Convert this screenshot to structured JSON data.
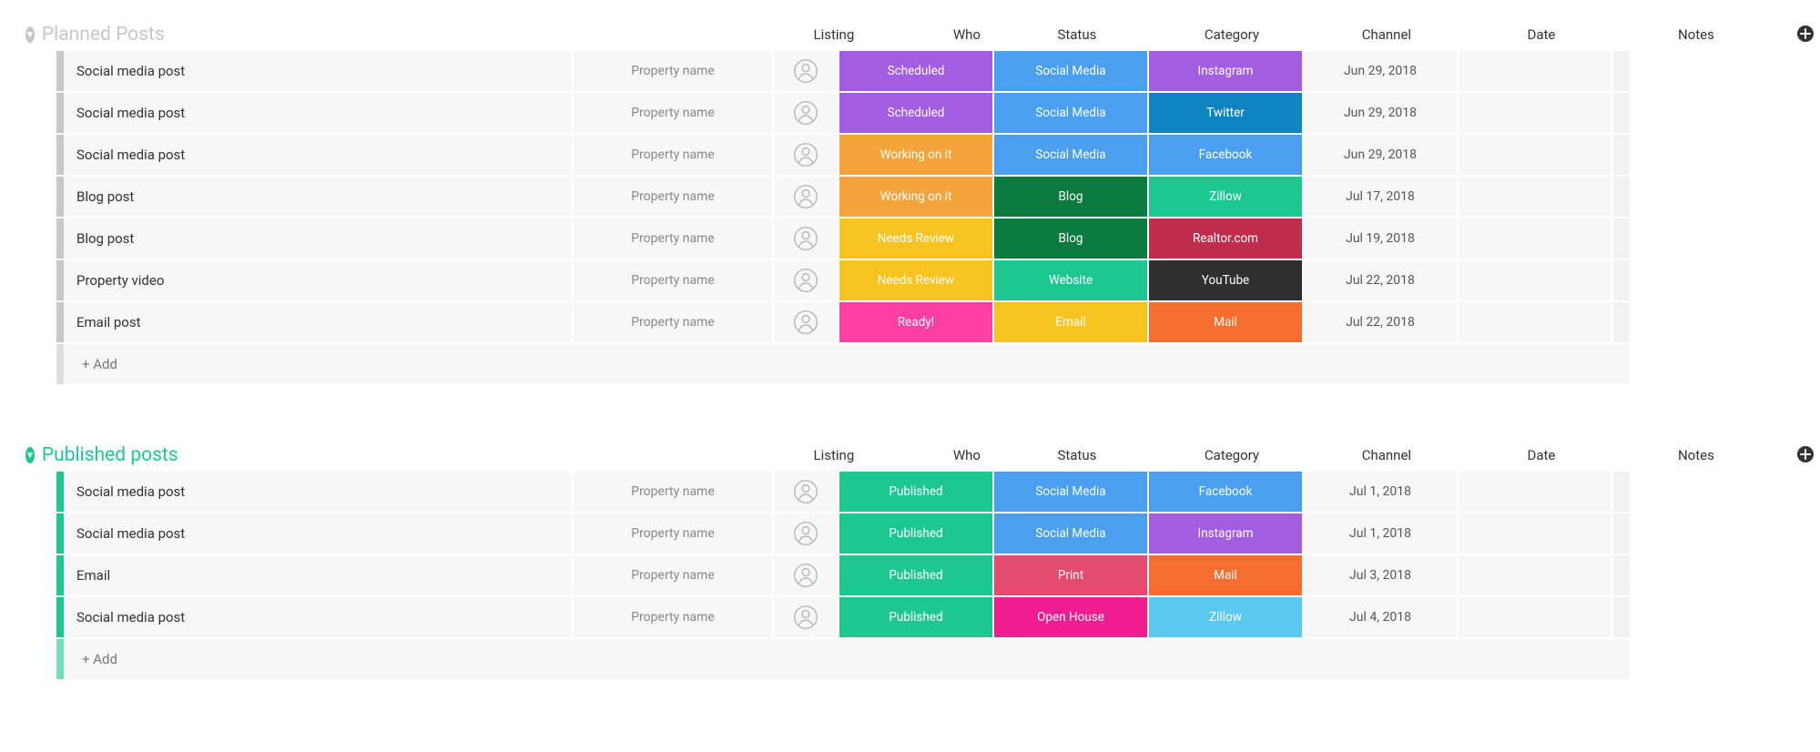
{
  "columns": {
    "listing": "Listing",
    "who": "Who",
    "status": "Status",
    "category": "Category",
    "channel": "Channel",
    "date": "Date",
    "notes": "Notes"
  },
  "add_label": "+ Add",
  "plus_glyph": "+",
  "groups": [
    {
      "id": "planned",
      "title": "Planned Posts",
      "tone": "muted",
      "rows": [
        {
          "name": "Social media post",
          "listing": "Property name",
          "status": {
            "label": "Scheduled",
            "color": "#a35de0"
          },
          "category": {
            "label": "Social Media",
            "color": "#4a9ff0"
          },
          "channel": {
            "label": "Instagram",
            "color": "#a35de0"
          },
          "date": "Jun 29, 2018"
        },
        {
          "name": "Social media post",
          "listing": "Property name",
          "status": {
            "label": "Scheduled",
            "color": "#a35de0"
          },
          "category": {
            "label": "Social Media",
            "color": "#4a9ff0"
          },
          "channel": {
            "label": "Twitter",
            "color": "#0f84c0"
          },
          "date": "Jun 29, 2018"
        },
        {
          "name": "Social media post",
          "listing": "Property name",
          "status": {
            "label": "Working on it",
            "color": "#f5a33b"
          },
          "category": {
            "label": "Social Media",
            "color": "#4a9ff0"
          },
          "channel": {
            "label": "Facebook",
            "color": "#4a9ff0"
          },
          "date": "Jun 29, 2018"
        },
        {
          "name": "Blog post",
          "listing": "Property name",
          "status": {
            "label": "Working on it",
            "color": "#f5a33b"
          },
          "category": {
            "label": "Blog",
            "color": "#0b7a3e"
          },
          "channel": {
            "label": "Zillow",
            "color": "#1ec690"
          },
          "date": "Jul 17, 2018"
        },
        {
          "name": "Blog post",
          "listing": "Property name",
          "status": {
            "label": "Needs Review",
            "color": "#f6c321"
          },
          "category": {
            "label": "Blog",
            "color": "#0b7a3e"
          },
          "channel": {
            "label": "Realtor.com",
            "color": "#bf2c4c"
          },
          "date": "Jul 19, 2018"
        },
        {
          "name": "Property video",
          "listing": "Property name",
          "status": {
            "label": "Needs Review",
            "color": "#f6c321"
          },
          "category": {
            "label": "Website",
            "color": "#1ec690"
          },
          "channel": {
            "label": "YouTube",
            "color": "#2f2f2f"
          },
          "date": "Jul 22, 2018"
        },
        {
          "name": "Email post",
          "listing": "Property name",
          "status": {
            "label": "Ready!",
            "color": "#ff3fa4"
          },
          "category": {
            "label": "Email",
            "color": "#f6c321"
          },
          "channel": {
            "label": "Mail",
            "color": "#f76c2f"
          },
          "date": "Jul 22, 2018"
        }
      ]
    },
    {
      "id": "published",
      "title": "Published posts",
      "tone": "green",
      "rows": [
        {
          "name": "Social media post",
          "listing": "Property name",
          "status": {
            "label": "Published",
            "color": "#1ec690"
          },
          "category": {
            "label": "Social Media",
            "color": "#4a9ff0"
          },
          "channel": {
            "label": "Facebook",
            "color": "#4a9ff0"
          },
          "date": "Jul 1, 2018"
        },
        {
          "name": "Social media post",
          "listing": "Property name",
          "status": {
            "label": "Published",
            "color": "#1ec690"
          },
          "category": {
            "label": "Social Media",
            "color": "#4a9ff0"
          },
          "channel": {
            "label": "Instagram",
            "color": "#a35de0"
          },
          "date": "Jul 1, 2018"
        },
        {
          "name": "Email",
          "listing": "Property name",
          "status": {
            "label": "Published",
            "color": "#1ec690"
          },
          "category": {
            "label": "Print",
            "color": "#e54a6f"
          },
          "channel": {
            "label": "Mail",
            "color": "#f76c2f"
          },
          "date": "Jul 3, 2018"
        },
        {
          "name": "Social media post",
          "listing": "Property name",
          "status": {
            "label": "Published",
            "color": "#1ec690"
          },
          "category": {
            "label": "Open House",
            "color": "#ef1d90"
          },
          "channel": {
            "label": "Zillow",
            "color": "#5ac8ef"
          },
          "date": "Jul 4, 2018"
        }
      ]
    }
  ]
}
